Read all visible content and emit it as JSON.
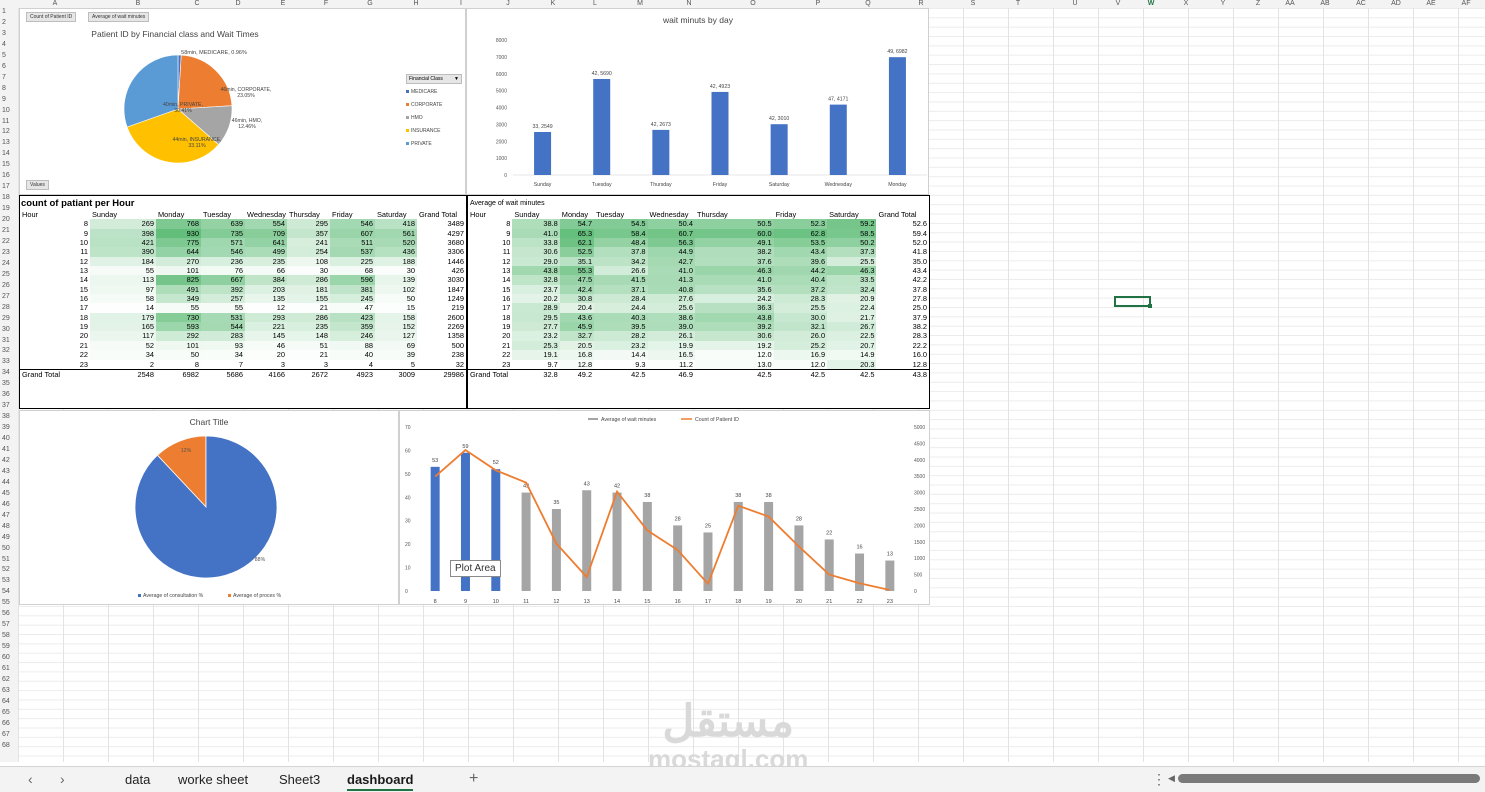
{
  "columns": [
    "A",
    "B",
    "C",
    "D",
    "E",
    "F",
    "G",
    "H",
    "I",
    "J",
    "K",
    "L",
    "M",
    "N",
    "O",
    "P",
    "Q",
    "R",
    "S",
    "T",
    "U",
    "V",
    "W",
    "X",
    "Y",
    "Z",
    "AA",
    "AB",
    "AC",
    "AD",
    "AE",
    "AF"
  ],
  "active_column": "W",
  "rows_count": 68,
  "pie1": {
    "buttons": [
      "Count of Patient ID",
      "Average of wait minutes"
    ],
    "values_button": "Values",
    "title": "Patient ID by Financial class and Wait Times",
    "legend_title": "Financial Class",
    "legend": [
      "MEDICARE",
      "CORPORATE",
      "HMO",
      "INSURANCE",
      "PRIVATE"
    ],
    "colors": [
      "#4472c4",
      "#ed7d31",
      "#a5a5a5",
      "#ffc000",
      "#5b9bd5"
    ],
    "chart_data": {
      "type": "pie",
      "categories": [
        "MEDICARE",
        "CORPORATE",
        "HMO",
        "INSURANCE",
        "PRIVATE"
      ],
      "values": [
        0.96,
        23.05,
        12.46,
        33.11,
        30.41
      ],
      "labels": [
        "58min, MEDICARE, 0.96%",
        "46min, CORPORATE, 23.05%",
        "46min, HMO, 12.46%",
        "44min, INSURANCE, 33.11%",
        "40min, PRIVATE, 30.41%"
      ]
    }
  },
  "bar1": {
    "title": "wait minuts by day",
    "chart_data": {
      "type": "bar",
      "categories": [
        "Sunday",
        "Tuesday",
        "Thursday",
        "Friday",
        "Saturday",
        "Wednesday",
        "Monday"
      ],
      "values": [
        2549,
        5690,
        2673,
        4923,
        3010,
        4171,
        6982
      ],
      "labels": [
        "33, 2549",
        "42, 5690",
        "42, 2673",
        "42, 4923",
        "42, 3010",
        "47, 4171",
        "49, 6982"
      ],
      "ylim": [
        0,
        8000
      ],
      "yticks": [
        0,
        1000,
        2000,
        3000,
        4000,
        5000,
        6000,
        7000,
        8000
      ],
      "color": "#4472c4"
    }
  },
  "count_table": {
    "title": "count of patiant per Hour",
    "headers": [
      "Hour",
      "Sunday",
      "Monday",
      "Tuesday",
      "Wednesday",
      "Thursday",
      "Friday",
      "Saturday",
      "Grand Total"
    ],
    "rows": [
      [
        "8",
        "269",
        "768",
        "639",
        "554",
        "295",
        "546",
        "418",
        "3489"
      ],
      [
        "9",
        "398",
        "930",
        "735",
        "709",
        "357",
        "607",
        "561",
        "4297"
      ],
      [
        "10",
        "421",
        "775",
        "571",
        "641",
        "241",
        "511",
        "520",
        "3680"
      ],
      [
        "11",
        "390",
        "644",
        "546",
        "499",
        "254",
        "537",
        "436",
        "3306"
      ],
      [
        "12",
        "184",
        "270",
        "236",
        "235",
        "108",
        "225",
        "188",
        "1446"
      ],
      [
        "13",
        "55",
        "101",
        "76",
        "66",
        "30",
        "68",
        "30",
        "426"
      ],
      [
        "14",
        "113",
        "825",
        "667",
        "384",
        "286",
        "596",
        "139",
        "3030"
      ],
      [
        "15",
        "97",
        "491",
        "392",
        "203",
        "181",
        "381",
        "102",
        "1847"
      ],
      [
        "16",
        "58",
        "349",
        "257",
        "135",
        "155",
        "245",
        "50",
        "1249"
      ],
      [
        "17",
        "14",
        "55",
        "55",
        "12",
        "21",
        "47",
        "15",
        "219"
      ],
      [
        "18",
        "179",
        "730",
        "531",
        "293",
        "286",
        "423",
        "158",
        "2600"
      ],
      [
        "19",
        "165",
        "593",
        "544",
        "221",
        "235",
        "359",
        "152",
        "2269"
      ],
      [
        "20",
        "117",
        "292",
        "283",
        "145",
        "148",
        "246",
        "127",
        "1358"
      ],
      [
        "21",
        "52",
        "101",
        "93",
        "46",
        "51",
        "88",
        "69",
        "500"
      ],
      [
        "22",
        "34",
        "50",
        "34",
        "20",
        "21",
        "40",
        "39",
        "238"
      ],
      [
        "23",
        "2",
        "8",
        "7",
        "3",
        "3",
        "4",
        "5",
        "32"
      ]
    ],
    "total": [
      "Grand Total",
      "2548",
      "6982",
      "5686",
      "4166",
      "2672",
      "4923",
      "3009",
      "29986"
    ]
  },
  "avg_table": {
    "title": "Average of wait minutes",
    "headers": [
      "Hour",
      "Sunday",
      "Monday",
      "Tuesday",
      "Wednesday",
      "Thursday",
      "Friday",
      "Saturday",
      "Grand Total"
    ],
    "rows": [
      [
        "8",
        "38.8",
        "54.7",
        "54.5",
        "50.4",
        "50.5",
        "52.3",
        "59.2",
        "52.6"
      ],
      [
        "9",
        "41.0",
        "65.3",
        "58.4",
        "60.7",
        "60.0",
        "62.8",
        "58.5",
        "59.4"
      ],
      [
        "10",
        "33.8",
        "62.1",
        "48.4",
        "56.3",
        "49.1",
        "53.5",
        "50.2",
        "52.0"
      ],
      [
        "11",
        "30.6",
        "52.5",
        "37.8",
        "44.9",
        "38.2",
        "43.4",
        "37.3",
        "41.8"
      ],
      [
        "12",
        "29.0",
        "35.1",
        "34.2",
        "42.7",
        "37.6",
        "39.6",
        "25.5",
        "35.0"
      ],
      [
        "13",
        "43.8",
        "55.3",
        "26.6",
        "41.0",
        "46.3",
        "44.2",
        "46.3",
        "43.4"
      ],
      [
        "14",
        "32.8",
        "47.5",
        "41.5",
        "41.3",
        "41.0",
        "40.4",
        "33.5",
        "42.2"
      ],
      [
        "15",
        "23.7",
        "42.4",
        "37.1",
        "40.8",
        "35.6",
        "37.2",
        "32.4",
        "37.8"
      ],
      [
        "16",
        "20.2",
        "30.8",
        "28.4",
        "27.6",
        "24.2",
        "28.3",
        "20.9",
        "27.8"
      ],
      [
        "17",
        "28.9",
        "20.4",
        "24.4",
        "25.6",
        "36.3",
        "25.5",
        "22.4",
        "25.0"
      ],
      [
        "18",
        "29.5",
        "43.6",
        "40.3",
        "38.6",
        "43.8",
        "30.0",
        "21.7",
        "37.9"
      ],
      [
        "19",
        "27.7",
        "45.9",
        "39.5",
        "39.0",
        "39.2",
        "32.1",
        "26.7",
        "38.2"
      ],
      [
        "20",
        "23.2",
        "32.7",
        "28.2",
        "26.1",
        "30.6",
        "26.0",
        "22.5",
        "28.3"
      ],
      [
        "21",
        "25.3",
        "20.5",
        "23.2",
        "19.9",
        "19.2",
        "25.2",
        "20.7",
        "22.2"
      ],
      [
        "22",
        "19.1",
        "16.8",
        "14.4",
        "16.5",
        "12.0",
        "16.9",
        "14.9",
        "16.0"
      ],
      [
        "23",
        "9.7",
        "12.8",
        "9.3",
        "11.2",
        "13.0",
        "12.0",
        "20.3",
        "12.8"
      ]
    ],
    "total": [
      "Grand Total",
      "32.8",
      "49.2",
      "42.5",
      "46.9",
      "42.5",
      "42.5",
      "42.5",
      "43.8"
    ]
  },
  "pie2": {
    "title": "Chart Title",
    "legend": [
      "Average of consultation %",
      "Average of proces %"
    ],
    "colors": [
      "#4472c4",
      "#ed7d31"
    ],
    "chart_data": {
      "type": "pie",
      "categories": [
        "Average of consultation %",
        "Average of proces %"
      ],
      "values": [
        88,
        12
      ],
      "labels": [
        "88%",
        "12%"
      ]
    }
  },
  "combo": {
    "legend": [
      "Average of wait minutes",
      "Count of Patient ID"
    ],
    "tooltip": "Plot Area",
    "colors": {
      "bar_selected": "#4472c4",
      "bar": "#a5a5a5",
      "line": "#ed7d31"
    },
    "chart_data": {
      "type": "bar",
      "categories": [
        "8",
        "9",
        "10",
        "11",
        "12",
        "13",
        "14",
        "15",
        "16",
        "17",
        "18",
        "19",
        "20",
        "21",
        "22",
        "23"
      ],
      "series": [
        {
          "name": "Average of wait minutes",
          "values": [
            53,
            59,
            52,
            42,
            35,
            43,
            42,
            38,
            28,
            25,
            38,
            38,
            28,
            22,
            16,
            13
          ]
        },
        {
          "name": "Count of Patient ID",
          "values": [
            3489,
            4297,
            3680,
            3306,
            1446,
            426,
            3030,
            1847,
            1249,
            219,
            2600,
            2269,
            1358,
            500,
            238,
            32
          ]
        }
      ],
      "selected_bars": [
        0,
        1,
        2
      ],
      "ylim_left": [
        0,
        70
      ],
      "yticks_left": [
        0,
        10,
        20,
        30,
        40,
        50,
        60,
        70
      ],
      "ylim_right": [
        0,
        5000
      ],
      "yticks_right": [
        0,
        500,
        1000,
        1500,
        2000,
        2500,
        3000,
        3500,
        4000,
        4500,
        5000
      ]
    }
  },
  "tabs": [
    "data",
    "worke sheet",
    "Sheet3",
    "dashboard"
  ],
  "active_tab": "dashboard",
  "nav": {
    "prev": "‹",
    "next": "›",
    "add": "+",
    "more": "⋮",
    "scroll_left": "◀"
  },
  "watermark": {
    "arabic": "مستقل",
    "latin": "mostaql.com"
  }
}
